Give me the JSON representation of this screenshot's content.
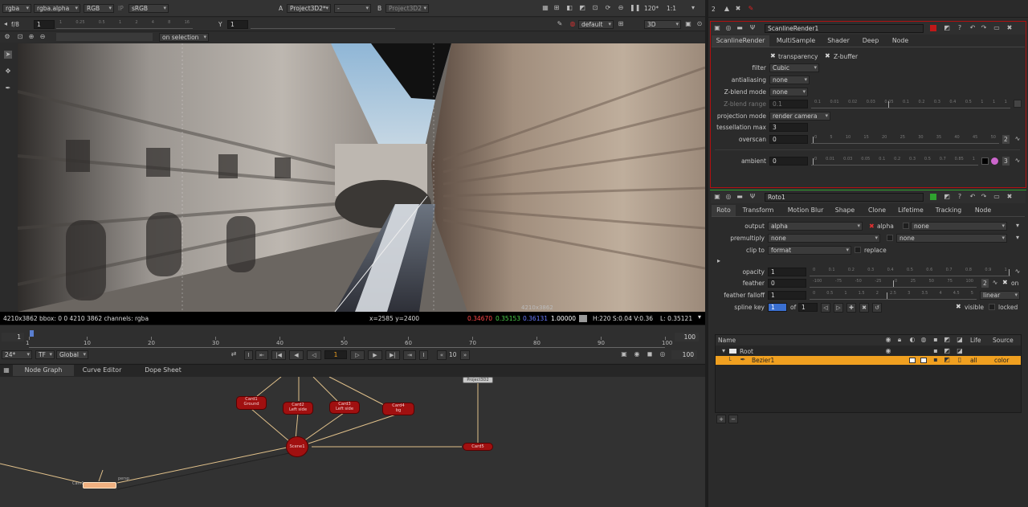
{
  "viewer": {
    "channels": "rgba",
    "alpha": "rgba.alpha",
    "rgb": "RGB",
    "ip": "IP",
    "colorspace": "sRGB",
    "input_a_label": "A",
    "input_a": "Project3D2*",
    "input_a_op": "-",
    "input_b_label": "B",
    "input_b": "Project3D2",
    "fps": "120*",
    "zoom": "1:1",
    "frame_label": "f/8",
    "frame_val": "1",
    "y_label": "Y",
    "y_val": "1",
    "gain_ticks": [
      "1",
      "0.25",
      "0.5",
      "1",
      "2",
      "4",
      "8",
      "16"
    ],
    "on_selection": "on selection",
    "lut": "default",
    "view_mode": "3D",
    "overlay_label": "4210x3862",
    "info_left": "4210x3862  bbox: 0 0 4210 3862 channels: rgba",
    "coords": "x=2585 y=2400",
    "r": "0.34670",
    "g": "0.35153",
    "b": "0.36131",
    "a": "1.00000",
    "hsv": "H:220 S:0.04 V:0.36",
    "lum": "L: 0.35121"
  },
  "timeline": {
    "start": "1",
    "end": "100",
    "ticks": [
      "1",
      "10",
      "20",
      "30",
      "40",
      "50",
      "60",
      "70",
      "80",
      "90",
      "100"
    ],
    "fps": "24*",
    "tf": "TF",
    "global": "Global",
    "current_frame": "1",
    "step": "10",
    "end_field": "100"
  },
  "panels": {
    "tabs": [
      "Node Graph",
      "Curve Editor",
      "Dope Sheet"
    ]
  },
  "nodes": [
    {
      "id": "card1",
      "l1": "Card1",
      "l2": "Ground"
    },
    {
      "id": "card2",
      "l1": "Card2",
      "l2": "Left side"
    },
    {
      "id": "card3",
      "l1": "Card3",
      "l2": "Left side"
    },
    {
      "id": "card4",
      "l1": "Card4",
      "l2": "bg"
    },
    {
      "id": "card5",
      "l1": "Card5",
      "l2": ""
    },
    {
      "id": "scene1",
      "l1": "Scene1",
      "l2": ""
    },
    {
      "id": "project",
      "l1": "Project3D2",
      "l2": ""
    },
    {
      "id": "cam",
      "l1": "Cam1",
      "l2": ""
    },
    {
      "id": "persp",
      "l1": "persp",
      "l2": ""
    }
  ],
  "props_toolbar": {
    "count": "2"
  },
  "scanline": {
    "title": "ScanlineRender1",
    "tabs": [
      "ScanlineRender",
      "MultiSample",
      "Shader",
      "Deep",
      "Node"
    ],
    "transparency": "transparency",
    "zbuffer": "Z-buffer",
    "filter_label": "filter",
    "filter": "Cubic",
    "antialiasing_label": "antialiasing",
    "antialiasing": "none",
    "zblend_label": "Z-blend mode",
    "zblend": "none",
    "zrange_label": "Z-blend range",
    "zrange": "0.1",
    "zrange_ticks": [
      "0.1",
      "0.01",
      "0.02",
      "0.03",
      "0.05",
      "0.1",
      "0.2",
      "0.3",
      "0.4",
      "0.5",
      "1",
      "1",
      "1"
    ],
    "proj_label": "projection mode",
    "proj": "render camera",
    "tess_label": "tessellation max",
    "tess": "3",
    "overscan_label": "overscan",
    "overscan": "0",
    "overscan_ticks": [
      "0",
      "5",
      "10",
      "15",
      "20",
      "25",
      "30",
      "35",
      "40",
      "45",
      "50"
    ],
    "overscan_count": "2",
    "ambient_label": "ambient",
    "ambient": "0",
    "ambient_ticks": [
      "0",
      "0.01",
      "0.03",
      "0.05",
      "0.1",
      "0.2",
      "0.3",
      "0.5",
      "0.7",
      "0.85",
      "1"
    ],
    "ambient_count": "3"
  },
  "roto": {
    "title": "Roto1",
    "tabs": [
      "Roto",
      "Transform",
      "Motion Blur",
      "Shape",
      "Clone",
      "Lifetime",
      "Tracking",
      "Node"
    ],
    "output_label": "output",
    "output": "alpha",
    "alpha_chk": "alpha",
    "output2": "none",
    "premult_label": "premultiply",
    "premult": "none",
    "premult2": "none",
    "clip_label": "clip to",
    "clip": "format",
    "replace": "replace",
    "opacity_label": "opacity",
    "opacity": "1",
    "opacity_ticks": [
      "0",
      "0.1",
      "0.2",
      "0.3",
      "0.4",
      "0.5",
      "0.6",
      "0.7",
      "0.8",
      "0.9",
      "1"
    ],
    "feather_label": "feather",
    "feather": "0",
    "feather_ticks": [
      "-100",
      "-75",
      "-50",
      "-25",
      "0",
      "25",
      "50",
      "75",
      "100"
    ],
    "feather_count": "2",
    "on": "on",
    "falloff_label": "feather falloff",
    "falloff": "1",
    "falloff_ticks": [
      "0",
      "0.5",
      "1",
      "1.5",
      "2",
      "2.5",
      "3",
      "3.5",
      "4",
      "4.5",
      "5"
    ],
    "falloff_mode": "linear",
    "spline_label": "spline key",
    "spline_key": "1",
    "of": "of",
    "of_val": "1",
    "visible": "visible",
    "locked": "locked",
    "cols": [
      "Name",
      "Life",
      "Source"
    ],
    "rows": [
      {
        "name": "Root",
        "life": "",
        "src": ""
      },
      {
        "name": "Bezier1",
        "life": "all",
        "src": "color"
      }
    ]
  },
  "colors": {
    "accent": "#f0a020",
    "node_red": "#a01010",
    "panel_bg": "#2b2b2b"
  }
}
